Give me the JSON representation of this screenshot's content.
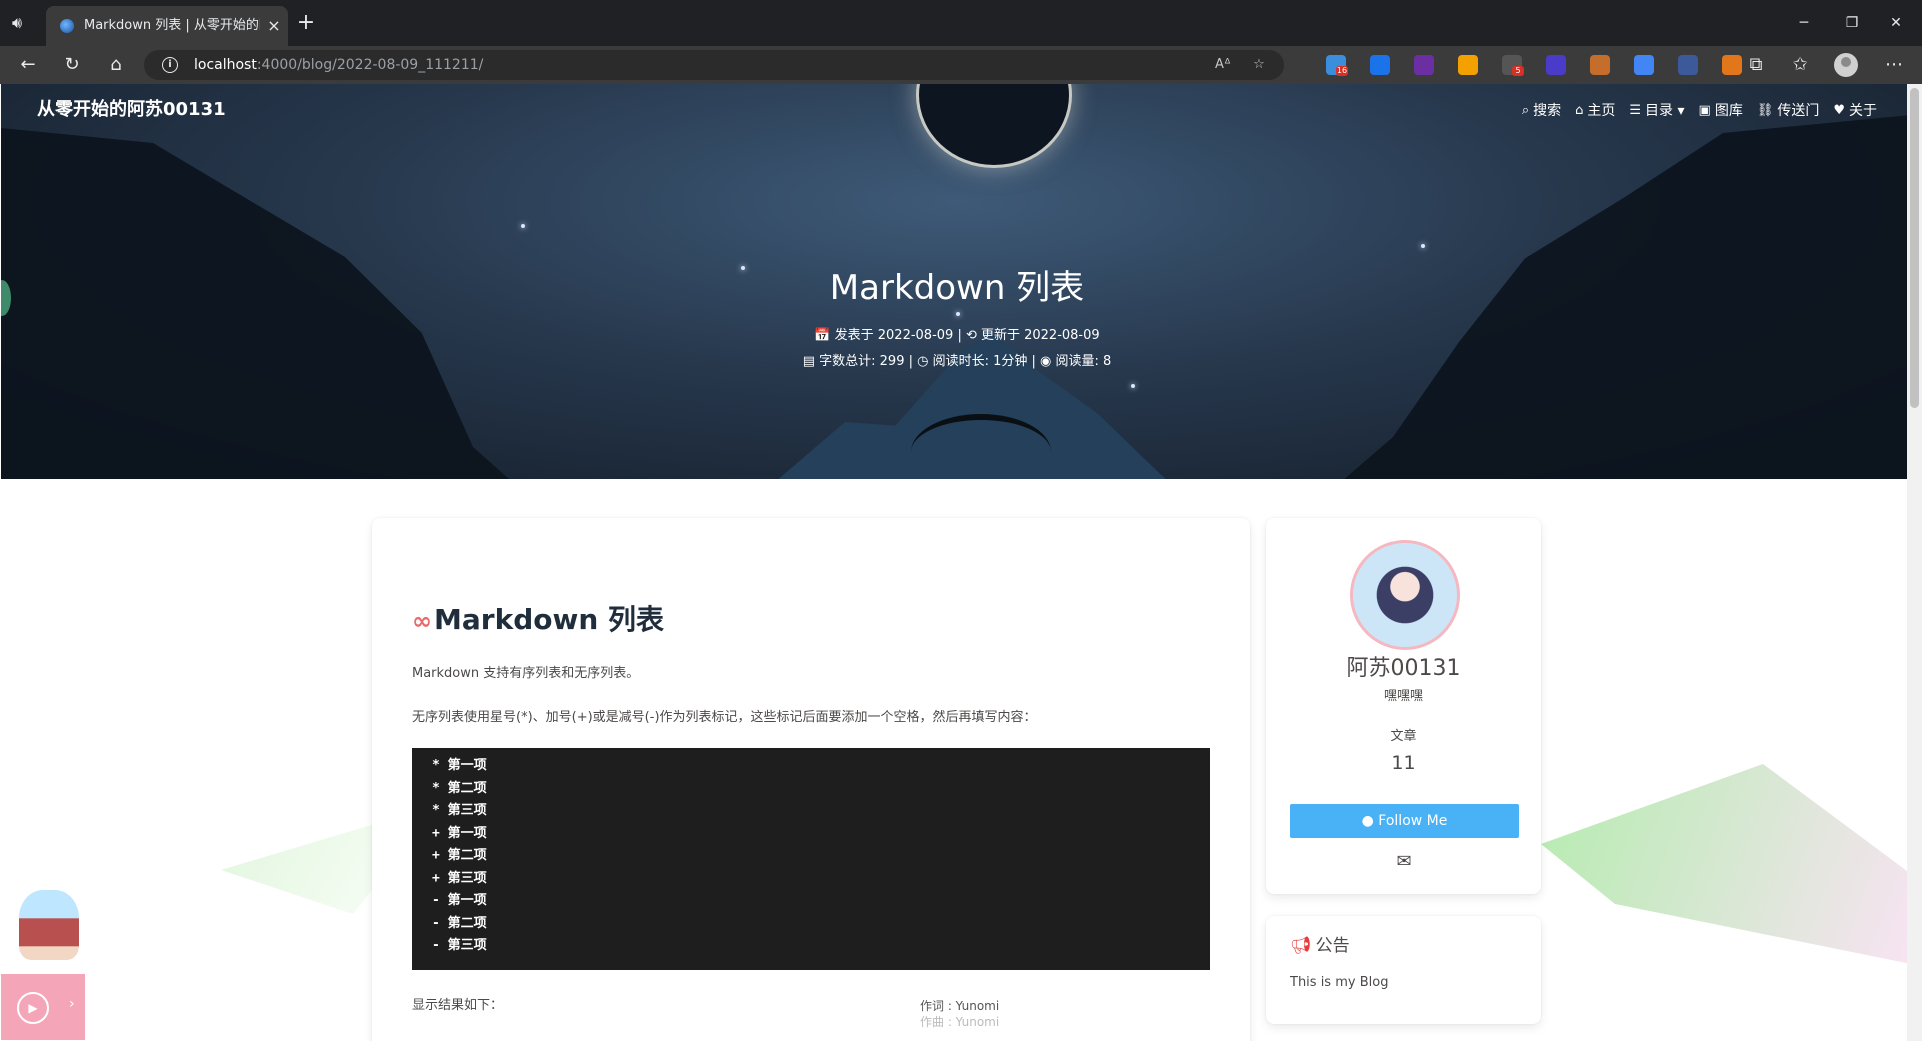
{
  "browser": {
    "tab_title": "Markdown 列表 | 从零开始的阿苏00131",
    "url_host": "localhost",
    "url_path": ":4000/blog/2022-08-09_111211/",
    "extensions": [
      {
        "name": "ext-1",
        "color": "#3a8edb",
        "badge": "16"
      },
      {
        "name": "ext-2",
        "color": "#1a73e8",
        "badge": ""
      },
      {
        "name": "ext-3",
        "color": "#6b2fa3",
        "badge": ""
      },
      {
        "name": "ext-4",
        "color": "#f2a100",
        "badge": ""
      },
      {
        "name": "ext-5",
        "color": "#555555",
        "badge": "5"
      },
      {
        "name": "ext-6",
        "color": "#4a3cc9",
        "badge": ""
      },
      {
        "name": "ext-7",
        "color": "#c56d2b",
        "badge": ""
      },
      {
        "name": "ext-8",
        "color": "#4285f4",
        "badge": ""
      },
      {
        "name": "ext-9",
        "color": "#3c5a99",
        "badge": ""
      },
      {
        "name": "ext-10",
        "color": "#e2761b",
        "badge": ""
      }
    ]
  },
  "site": {
    "title": "从零开始的阿苏00131",
    "nav": [
      {
        "icon": "search-icon",
        "glyph": "⌕",
        "label": "搜索"
      },
      {
        "icon": "home-icon",
        "glyph": "⌂",
        "label": "主页"
      },
      {
        "icon": "list-icon",
        "glyph": "☰",
        "label": "目录 ▾"
      },
      {
        "icon": "gallery-icon",
        "glyph": "▣",
        "label": "图库"
      },
      {
        "icon": "link-icon",
        "glyph": "⛓",
        "label": "传送门"
      },
      {
        "icon": "heart-icon",
        "glyph": "♥",
        "label": "关于"
      }
    ]
  },
  "post": {
    "title": "Markdown 列表",
    "meta_line1": "📅 发表于 2022-08-09 | ⟲ 更新于 2022-08-09",
    "meta_line2": "▤ 字数总计: 299 | ◷ 阅读时长: 1分钟 | ◉ 阅读量: 8"
  },
  "article": {
    "heading": "Markdown 列表",
    "intro": "Markdown 支持有序列表和无序列表。",
    "unordered_desc": "无序列表使用星号(*)、加号(+)或是减号(-)作为列表标记，这些标记后面要添加一个空格，然后再填写内容：",
    "code_lines": [
      "* 第一项",
      "* 第二项",
      "* 第三项",
      "+ 第一项",
      "+ 第二项",
      "+ 第三项",
      "- 第一项",
      "- 第二项",
      "- 第三项"
    ],
    "result_label": "显示结果如下：",
    "lyric_1": "作词 : Yunomi",
    "lyric_2": "作曲 : Yunomi"
  },
  "profile": {
    "name": "阿苏00131",
    "description": "嘿嘿嘿",
    "stat_label": "文章",
    "stat_value": "11",
    "follow_label": "Follow Me"
  },
  "notice": {
    "title": "公告",
    "body": "This is my Blog"
  },
  "colors": {
    "accent": "#49b1f5",
    "code_bg": "#1e1e1e",
    "link_icon": "#e86a6a",
    "notice_icon": "#e83b3b"
  }
}
